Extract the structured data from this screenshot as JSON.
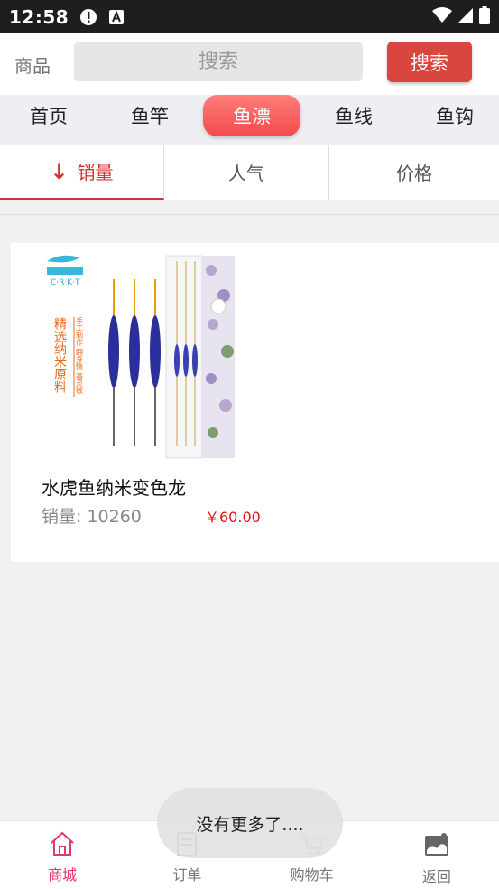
{
  "statusbar": {
    "time": "12:58"
  },
  "search": {
    "label": "商品",
    "placeholder": "搜索",
    "button_label": "搜索"
  },
  "categories": [
    {
      "label": "首页",
      "active": false
    },
    {
      "label": "鱼竿",
      "active": false
    },
    {
      "label": "鱼漂",
      "active": true
    },
    {
      "label": "鱼线",
      "active": false
    },
    {
      "label": "鱼钩",
      "active": false
    }
  ],
  "sort": [
    {
      "label": "销量",
      "active": true,
      "arrow": "↓"
    },
    {
      "label": "人气",
      "active": false
    },
    {
      "label": "价格",
      "active": false
    }
  ],
  "product": {
    "name": "水虎鱼纳米变色龙",
    "sales": "销量: 10260",
    "price": "￥60.00",
    "image_brand": "C·R·K·T",
    "image_text_vertical": "精选纳米原料",
    "image_text_small": "手工制作 翻身快 高灵敏"
  },
  "toast": "没有更多了....",
  "bottom_nav": [
    {
      "label": "商城",
      "icon": "home-icon",
      "active": true
    },
    {
      "label": "订单",
      "icon": "order-icon",
      "active": false
    },
    {
      "label": "购物车",
      "icon": "cart-icon",
      "active": false
    },
    {
      "label": "返回",
      "icon": "back-icon",
      "active": false
    }
  ],
  "colors": {
    "accent": "#d9463e",
    "category_active": "#f24b4b",
    "sort_active": "#d43030",
    "price": "#e01818",
    "nav_active": "#e5376b"
  }
}
